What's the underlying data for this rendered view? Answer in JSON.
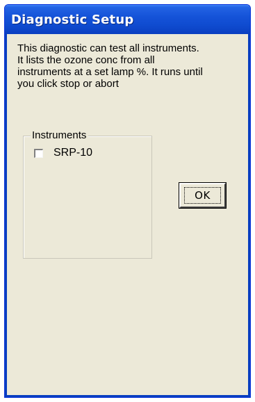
{
  "window": {
    "title": "Diagnostic Setup"
  },
  "description": {
    "lines": [
      "This diagnostic can test all instruments.",
      "It lists the ozone conc from all",
      "instruments at a set lamp %.  It runs until",
      "you click stop or abort"
    ]
  },
  "instruments_group": {
    "label": "Instruments",
    "items": [
      {
        "label": "SRP-10",
        "checked": false
      }
    ]
  },
  "buttons": {
    "ok_label": "OK"
  },
  "colors": {
    "titlebar": "#0f4bd0",
    "dialog_background": "#ece9d8",
    "frame_border": "#0a3fc0"
  }
}
